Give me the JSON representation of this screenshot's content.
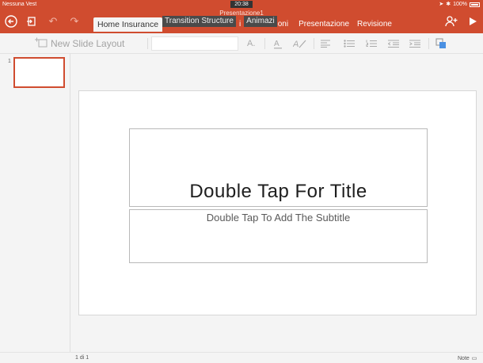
{
  "status": {
    "carrier": "Nessuna Vest",
    "time": "20:38",
    "battery": "100%"
  },
  "document": {
    "title": "Presentazione1"
  },
  "tabs": [
    {
      "label": "Home Insurance"
    },
    {
      "label": "Transition Structure"
    },
    {
      "label": "i"
    },
    {
      "label": "Animazi"
    },
    {
      "label": "oni"
    },
    {
      "label": "Presentazione"
    },
    {
      "label": "Revisione"
    }
  ],
  "ribbon": {
    "new_slide_label": "New Slide Layout",
    "font_size_label": "A."
  },
  "slide_panel": {
    "thumb_number": "1"
  },
  "slide": {
    "title_placeholder": "Double Tap For Title",
    "subtitle_placeholder": "Double Tap To Add The Subtitle"
  },
  "footer": {
    "slide_count": "1 di 1",
    "notes_label": "Note"
  },
  "colors": {
    "accent": "#d04c2f",
    "selection": "#d04c2f"
  },
  "icons": [
    "back-icon",
    "file-icon",
    "undo-icon",
    "redo-icon",
    "share-person-icon",
    "play-icon"
  ]
}
